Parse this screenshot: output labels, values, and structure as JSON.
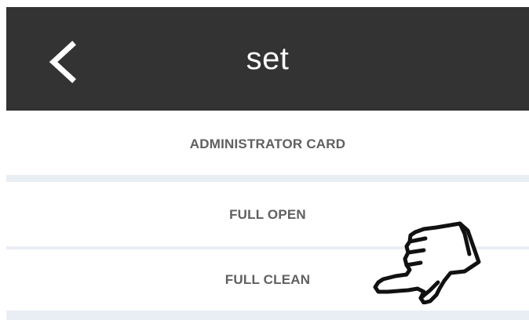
{
  "header": {
    "title": "set",
    "back_icon": "chevron-left-icon"
  },
  "menu": {
    "items": [
      {
        "label": "ADMINISTRATOR CARD"
      },
      {
        "label": "FULL OPEN"
      },
      {
        "label": "FULL CLEAN"
      }
    ]
  },
  "pointer": {
    "icon": "pointing-hand-icon"
  },
  "colors": {
    "header_bg": "#333333",
    "header_text": "#ffffff",
    "item_text": "#606060",
    "divider": "#e9edf4",
    "background": "#ffffff"
  }
}
